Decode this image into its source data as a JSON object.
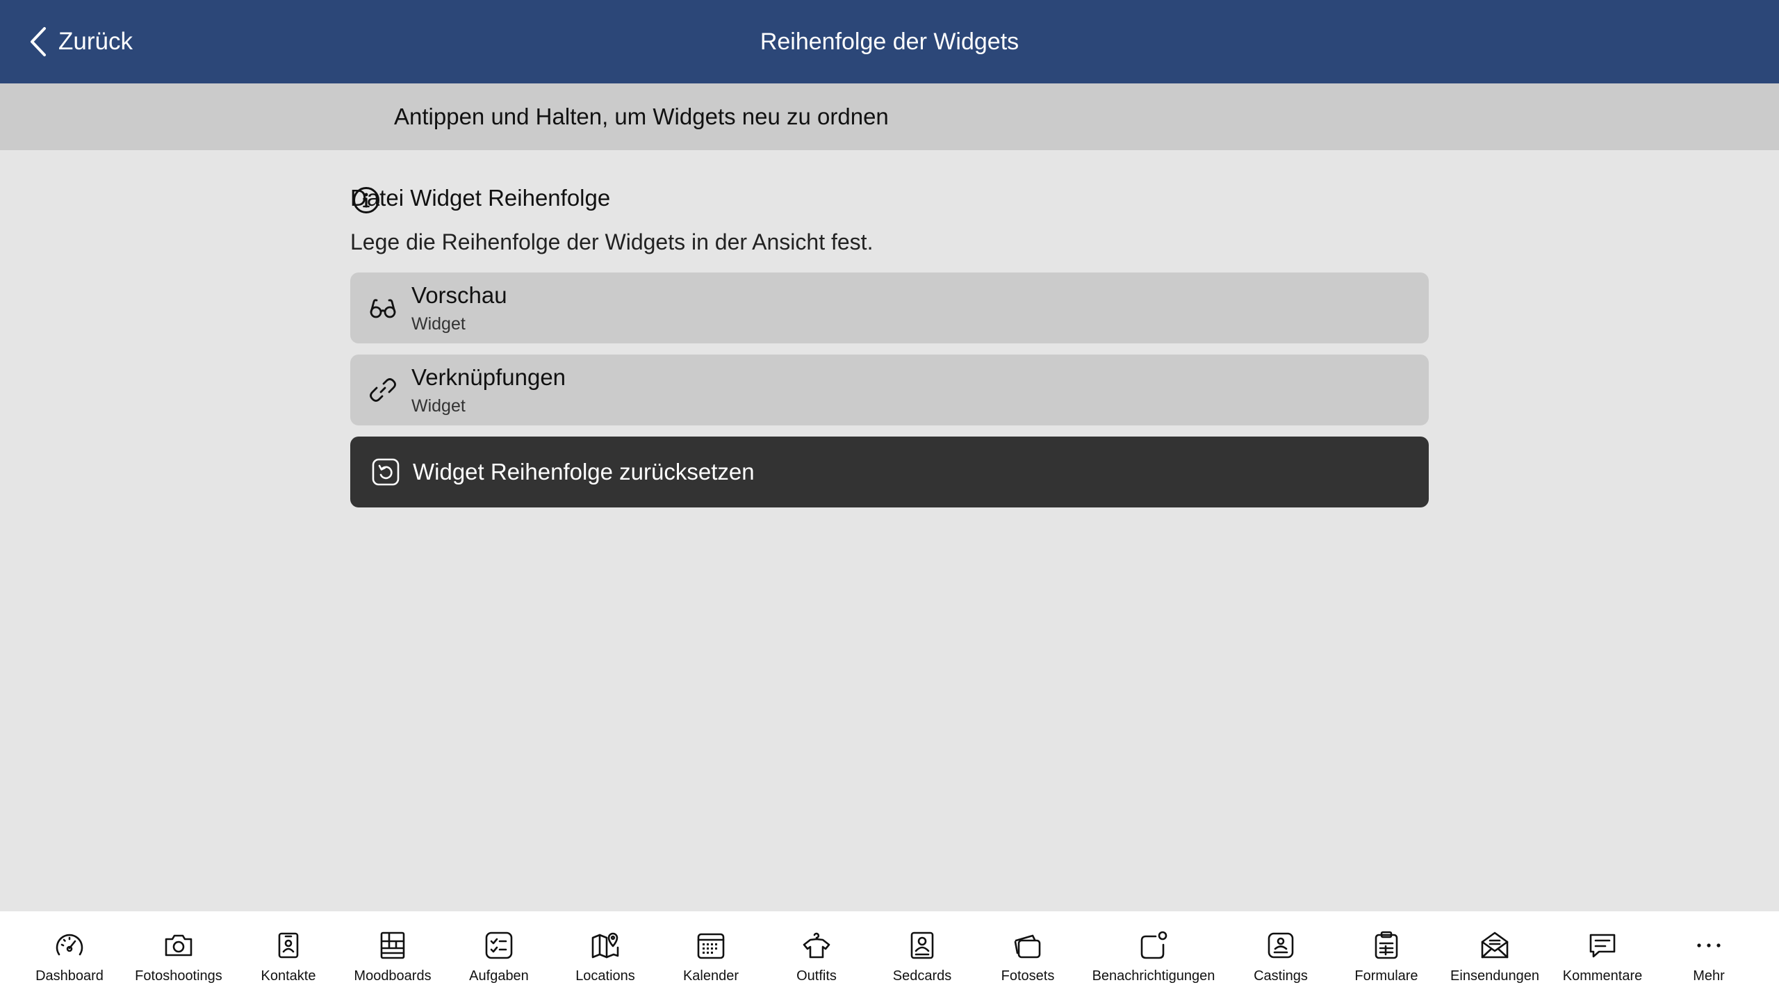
{
  "header": {
    "back_label": "Zurück",
    "title": "Reihenfolge der Widgets",
    "background_color": "#2c4778"
  },
  "info_bar": {
    "icon": "info-icon",
    "text": "Antippen und Halten, um Widgets neu zu ordnen"
  },
  "section": {
    "title": "Datei Widget Reihenfolge",
    "description": "Lege die Reihenfolge der Widgets in der Ansicht fest."
  },
  "widgets": [
    {
      "icon": "glasses-icon",
      "name": "Vorschau",
      "type": "Widget"
    },
    {
      "icon": "link-icon",
      "name": "Verknüpfungen",
      "type": "Widget"
    }
  ],
  "reset_button": {
    "icon": "reset-icon",
    "label": "Widget Reihenfolge zurücksetzen"
  },
  "tab_bar": {
    "items": [
      {
        "icon": "speedometer-icon",
        "label": "Dashboard"
      },
      {
        "icon": "camera-icon",
        "label": "Fotoshootings"
      },
      {
        "icon": "contact-card-icon",
        "label": "Kontakte"
      },
      {
        "icon": "moodboard-grid-icon",
        "label": "Moodboards"
      },
      {
        "icon": "checklist-icon",
        "label": "Aufgaben"
      },
      {
        "icon": "map-pin-icon",
        "label": "Locations"
      },
      {
        "icon": "calendar-icon",
        "label": "Kalender"
      },
      {
        "icon": "shirt-hanger-icon",
        "label": "Outfits"
      },
      {
        "icon": "portrait-card-icon",
        "label": "Sedcards"
      },
      {
        "icon": "photo-stack-icon",
        "label": "Fotosets"
      },
      {
        "icon": "notification-badge-icon",
        "label": "Benachrichtigungen"
      },
      {
        "icon": "casting-badge-icon",
        "label": "Castings"
      },
      {
        "icon": "clipboard-form-icon",
        "label": "Formulare"
      },
      {
        "icon": "mail-envelope-icon",
        "label": "Einsendungen"
      },
      {
        "icon": "comment-bubble-icon",
        "label": "Kommentare"
      },
      {
        "icon": "more-dots-icon",
        "label": "Mehr"
      }
    ]
  }
}
